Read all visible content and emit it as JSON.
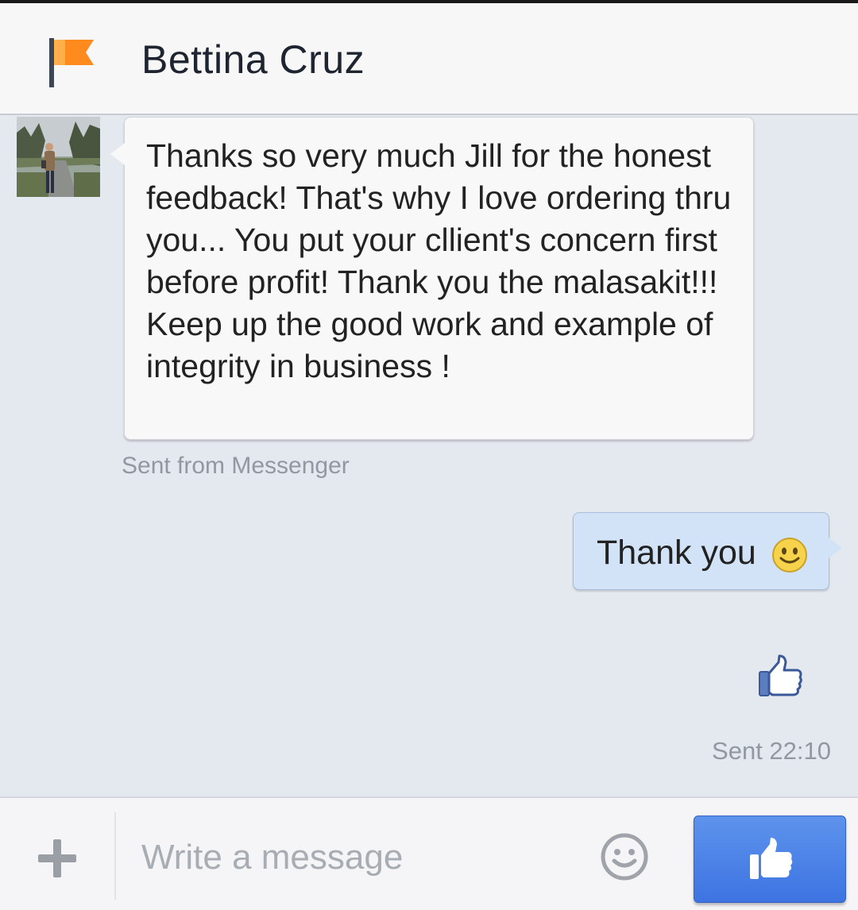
{
  "header": {
    "contact_name": "Bettina Cruz",
    "icon": "flag-icon"
  },
  "conversation": {
    "received": {
      "text": "Thanks so very much Jill for the honest feedback! That's why I love ordering thru you... You put your cllient's concern first before profit! Thank you the malasakit!!! Keep up the good work and example of integrity in business !",
      "sent_from": "Sent from Messenger",
      "avatar": "avatar-photo"
    },
    "sent": {
      "text": "Thank you",
      "emoji": "smiley-emoji",
      "sticker": "thumbs-up-sticker",
      "status": "Sent 22:10"
    }
  },
  "composer": {
    "placeholder": "Write a message",
    "value": "",
    "add_icon": "plus-icon",
    "emoji_icon": "smiley-icon",
    "send_icon": "thumbs-up-icon"
  },
  "colors": {
    "accent_blue": "#4a82e8",
    "flag_orange": "#ff8a1e",
    "sent_bubble": "#d2e3f7",
    "received_bubble": "#f8f8f8"
  }
}
